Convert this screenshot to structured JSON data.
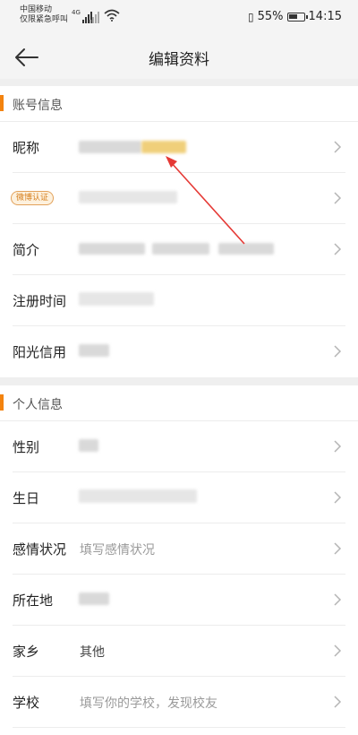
{
  "status_bar": {
    "carrier_line1": "中国移动",
    "carrier_line2": "仅限紧急呼叫",
    "network_type": "4G",
    "battery_percent": "55%",
    "time": "14:15"
  },
  "header": {
    "title": "编辑资料",
    "back_icon": "arrow-left-icon"
  },
  "sections": {
    "account": {
      "title": "账号信息",
      "rows": {
        "nickname": "昵称",
        "weibo_badge": "微博认证",
        "intro": "简介",
        "register_time": "注册时间",
        "sunshine_credit": "阳光信用"
      }
    },
    "personal": {
      "title": "个人信息",
      "rows": {
        "gender": "性别",
        "birthday": "生日",
        "relationship_label": "感情状况",
        "relationship_placeholder": "填写感情状况",
        "location": "所在地",
        "hometown_label": "家乡",
        "hometown_value": "其他",
        "school_label": "学校",
        "school_placeholder": "填写你的学校，发现校友"
      }
    }
  },
  "colors": {
    "accent": "#f3830f",
    "annotation_arrow": "#e53935",
    "badge_text": "#d67e1c"
  }
}
